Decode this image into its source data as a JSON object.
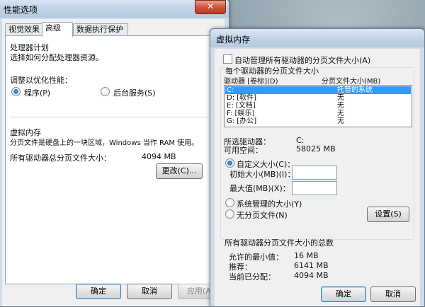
{
  "perf": {
    "title": "性能选项",
    "close": "✕",
    "tabs": [
      "视觉效果",
      "高级",
      "数据执行保护"
    ],
    "processor": {
      "group_title": "处理器计划",
      "desc": "选择如何分配处理器资源。",
      "adjust_label": "调整以优化性能：",
      "opt_programs": "程序(P)",
      "opt_services": "后台服务(S)"
    },
    "vm": {
      "group_title": "虚拟内存",
      "desc": "分页文件是硬盘上的一块区域，Windows 当作 RAM 使用。",
      "total_label": "所有驱动器总分页文件大小：",
      "total_value": "4094 MB",
      "change_button": "更改(C)..."
    },
    "buttons": {
      "ok": "确定",
      "cancel": "取消",
      "apply": "应用(A)"
    }
  },
  "vmdlg": {
    "title": "虚拟内存",
    "auto_manage": "自动管理所有驱动器的分页文件大小(A)",
    "section_title": "每个驱动器的分页文件大小",
    "col_drive": "驱动器 [卷标](D)",
    "col_size": "分页文件大小(MB)",
    "drives": [
      {
        "drive": "C:",
        "size": "托管的系统"
      },
      {
        "drive": "D:    [软件]",
        "size": "无"
      },
      {
        "drive": "E:    [文档]",
        "size": "无"
      },
      {
        "drive": "F:    [娱乐]",
        "size": "无"
      },
      {
        "drive": "G:    [办公]",
        "size": "无"
      }
    ],
    "selected_drive_label": "所选驱动器：",
    "selected_drive_value": "C:",
    "free_space_label": "可用空间：",
    "free_space_value": "58025 MB",
    "custom_size": "自定义大小(C)：",
    "initial_size": "初始大小(MB)(I)：",
    "max_size": "最大值(MB)(X)：",
    "system_managed": "系统管理的大小(Y)",
    "no_paging": "无分页文件(N)",
    "set_button": "设置(S)",
    "total_title": "所有驱动器分页文件大小的总数",
    "min_allowed_label": "允许的最小值：",
    "min_allowed_value": "16 MB",
    "recommended_label": "推荐：",
    "recommended_value": "6141 MB",
    "current_label": "当前已分配：",
    "current_value": "4094 MB",
    "ok": "确定",
    "cancel": "取消"
  }
}
